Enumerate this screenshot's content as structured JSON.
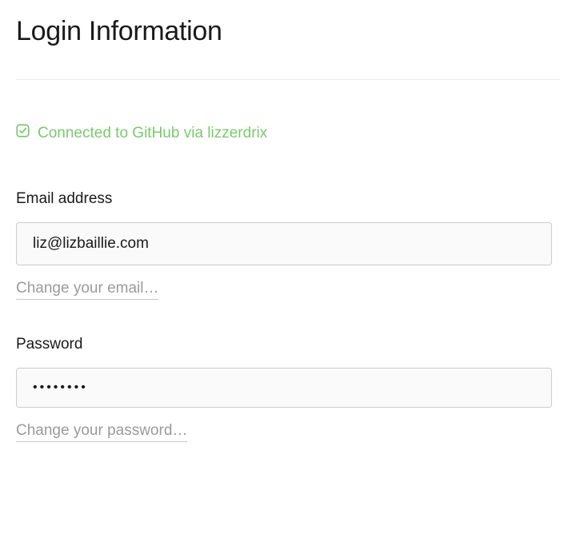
{
  "page": {
    "title": "Login Information"
  },
  "connection": {
    "status_text": "Connected to GitHub via lizzerdrix"
  },
  "email": {
    "label": "Email address",
    "value": "liz@lizbaillie.com",
    "change_link": "Change your email…"
  },
  "password": {
    "label": "Password",
    "value": "••••••••",
    "change_link": "Change your password…"
  }
}
